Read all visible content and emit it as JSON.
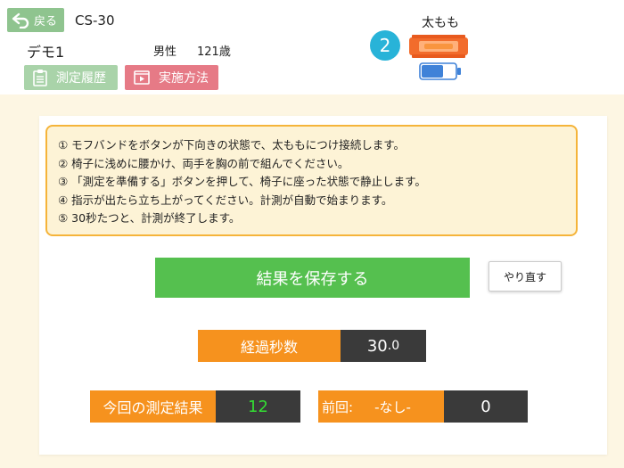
{
  "header": {
    "back_label": "戻る",
    "device_id": "CS-30",
    "user_name": "デモ1",
    "gender": "男性",
    "age": "121歳",
    "history_button": "測定履歴",
    "method_button": "実施方法",
    "sensor_number": "2",
    "body_part": "太もも"
  },
  "instructions": [
    "① モフバンドをボタンが下向きの状態で、太ももにつけ接続します。",
    "② 椅子に浅めに腰かけ、両手を胸の前で組んでください。",
    "③ 「測定を準備する」ボタンを押して、椅子に座った状態で静止します。",
    "④ 指示が出たら立ち上がってください。計測が自動で始まります。",
    "⑤ 30秒たつと、計測が終了します。"
  ],
  "actions": {
    "save_label": "結果を保存する",
    "redo_label": "やり直す"
  },
  "elapsed": {
    "label": "経過秒数",
    "value_int": "30",
    "value_frac": ".0"
  },
  "current_result": {
    "label": "今回の測定結果",
    "value": "12"
  },
  "previous_result": {
    "label": "前回:",
    "none_text": "-なし-",
    "value": "0"
  },
  "colors": {
    "green": "#55c04f",
    "orange": "#f6921e",
    "dark": "#3a3a3a",
    "sensor_blue": "#28b3d8",
    "pink": "#e67a86",
    "result_green": "#33dd33"
  },
  "icons": {
    "back": "back-arrow-icon",
    "history": "clipboard-icon",
    "method": "video-icon",
    "band": "band-sensor-icon",
    "battery": "battery-icon"
  }
}
